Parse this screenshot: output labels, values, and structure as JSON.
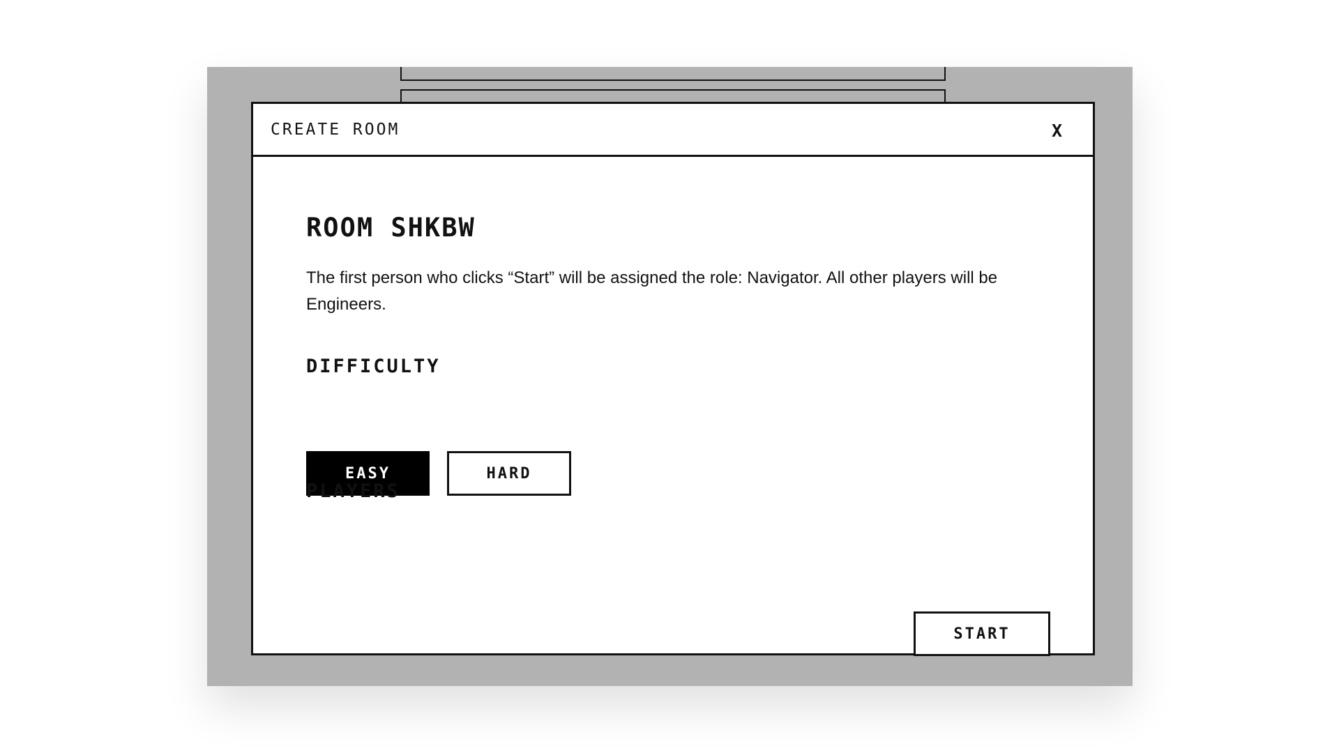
{
  "modal": {
    "title": "CREATE ROOM",
    "close_label": "X"
  },
  "room": {
    "heading": "ROOM SHKBW",
    "description": "The first person who clicks “Start” will be assigned the role: Navigator. All other players will be Engineers."
  },
  "difficulty": {
    "label": "DIFFICULTY",
    "options": [
      "EASY",
      "HARD"
    ],
    "selected": "EASY"
  },
  "players": {
    "label": "PLAYERS"
  },
  "actions": {
    "start_label": "START"
  },
  "colors": {
    "backdrop": "#b2b2b2",
    "border": "#111111",
    "selected_bg": "#000000",
    "selected_fg": "#ffffff"
  }
}
